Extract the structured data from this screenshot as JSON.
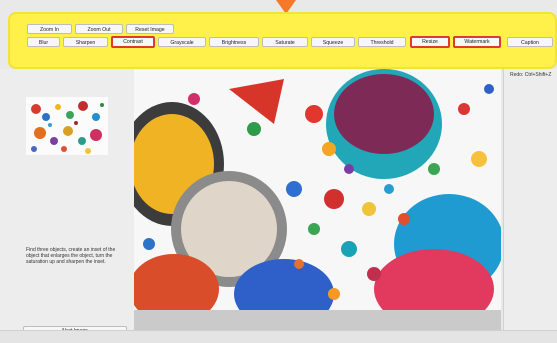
{
  "toolbar": {
    "row1": [
      "Zoom In",
      "Zoom Out",
      "Reset Image"
    ],
    "row2": [
      "Blur",
      "Sharpen",
      "Contrast",
      "Grayscale",
      "Brightness",
      "Saturate",
      "Squeeze",
      "Threshold",
      "Resize",
      "Watermark",
      "Caption"
    ],
    "highlighted": [
      "Contrast",
      "Resize",
      "Watermark"
    ],
    "highlight_color": "#e13a2b",
    "overlay_color": "#fff04a",
    "arrow_color": "#f47a2a"
  },
  "left_panel": {
    "instructions": "Find three objects, create an inset of the object that enlarges the object, turn the saturation up and sharpen the inset.",
    "next_button": "Next Image"
  },
  "right_panel": {
    "redo_text": "Redo: Ctrl+Shift+Z"
  }
}
